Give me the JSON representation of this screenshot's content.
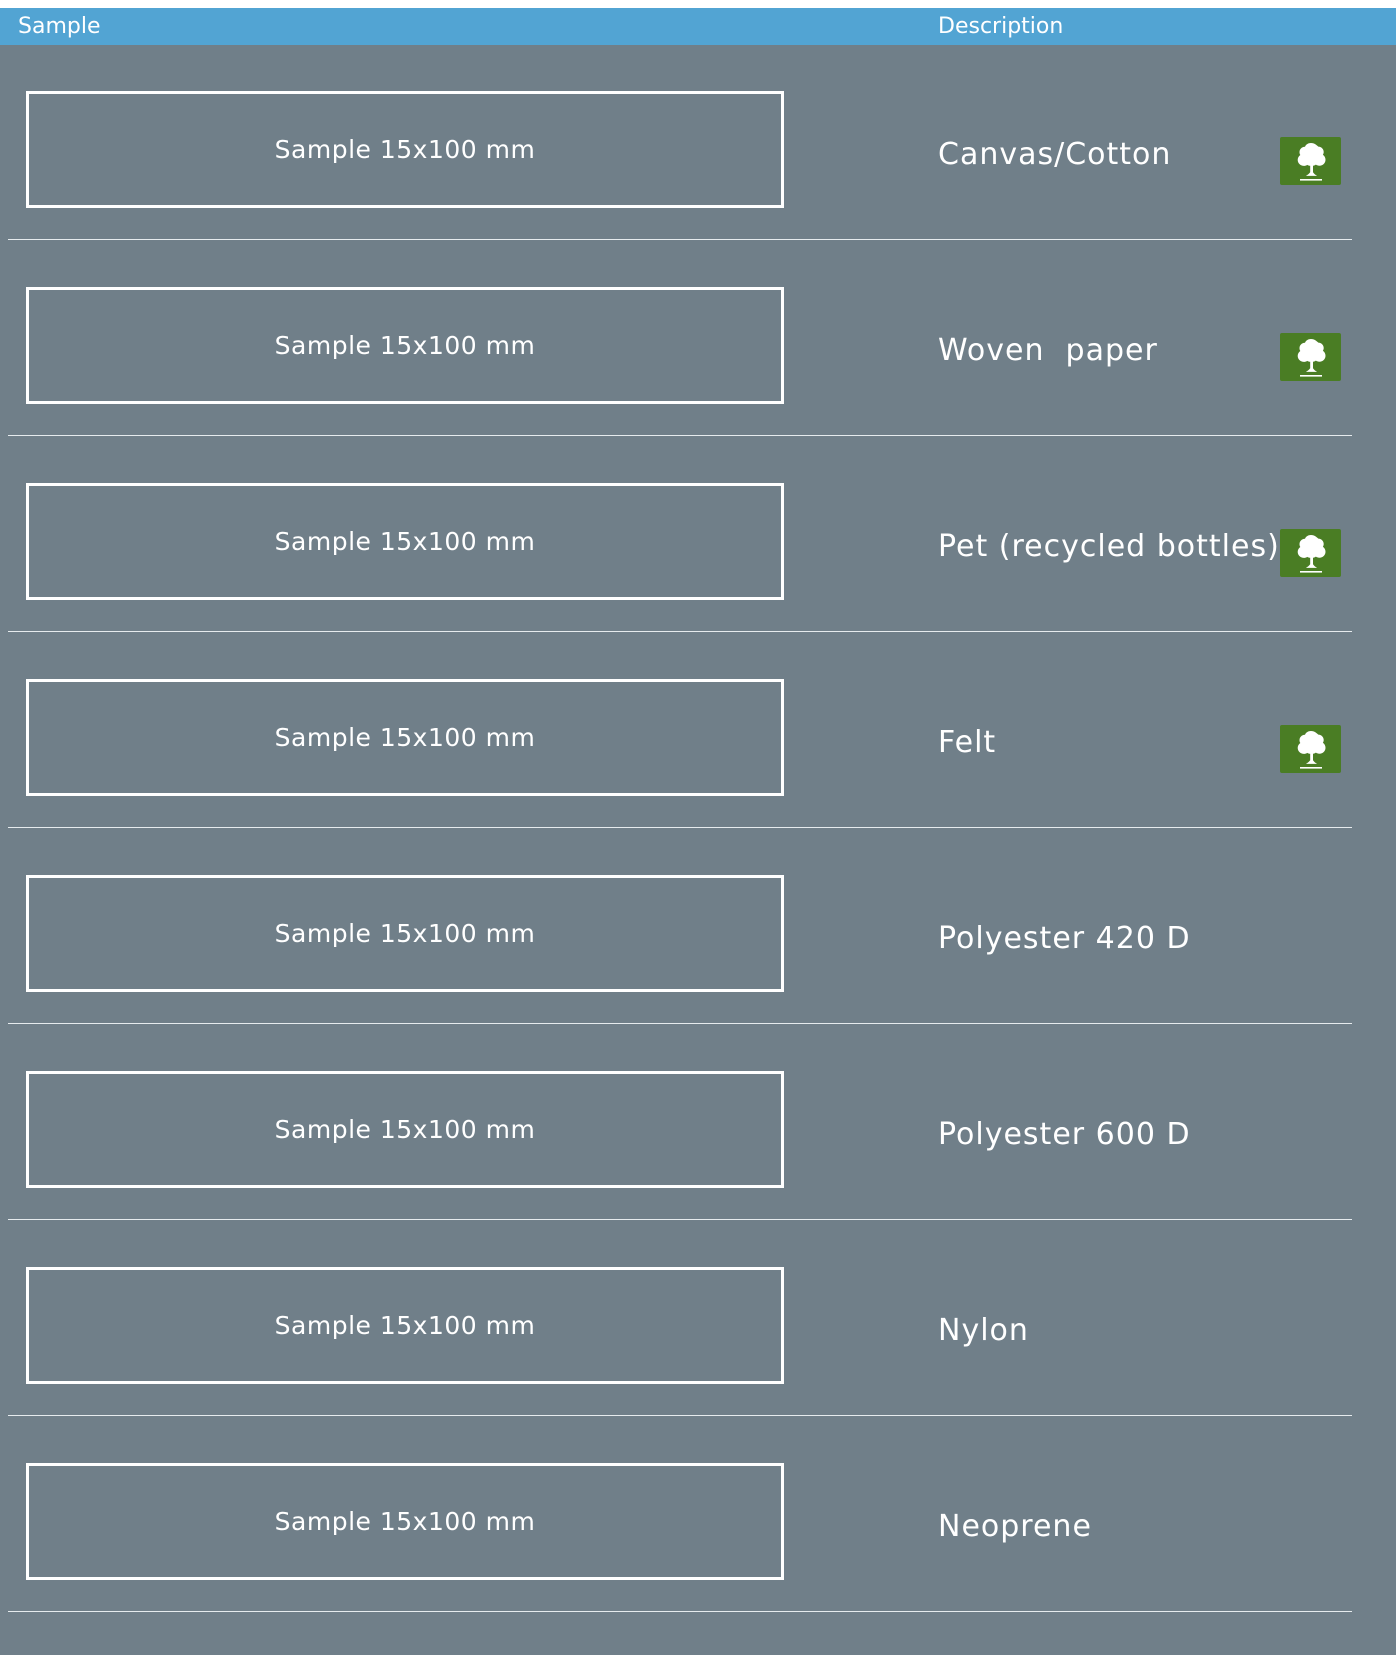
{
  "header": {
    "sample_label": "Sample",
    "description_label": "Description"
  },
  "colors": {
    "panel_background": "#707f89",
    "header_background": "#52a4d3",
    "eco_icon_background": "#4a7d24",
    "text": "#ffffff"
  },
  "rows": [
    {
      "sample": "Sample 15x100 mm",
      "description": "Canvas/Cotton",
      "eco": true,
      "icon": "tree-icon"
    },
    {
      "sample": "Sample 15x100 mm",
      "description": "Woven  paper",
      "eco": true,
      "icon": "tree-icon"
    },
    {
      "sample": "Sample 15x100 mm",
      "description": "Pet (recycled bottles)",
      "eco": true,
      "icon": "tree-icon"
    },
    {
      "sample": "Sample 15x100 mm",
      "description": "Felt",
      "eco": true,
      "icon": "tree-icon"
    },
    {
      "sample": "Sample 15x100 mm",
      "description": "Polyester 420 D",
      "eco": false
    },
    {
      "sample": "Sample 15x100 mm",
      "description": "Polyester 600 D",
      "eco": false
    },
    {
      "sample": "Sample 15x100 mm",
      "description": "Nylon",
      "eco": false
    },
    {
      "sample": "Sample 15x100 mm",
      "description": "Neoprene",
      "eco": false
    }
  ]
}
